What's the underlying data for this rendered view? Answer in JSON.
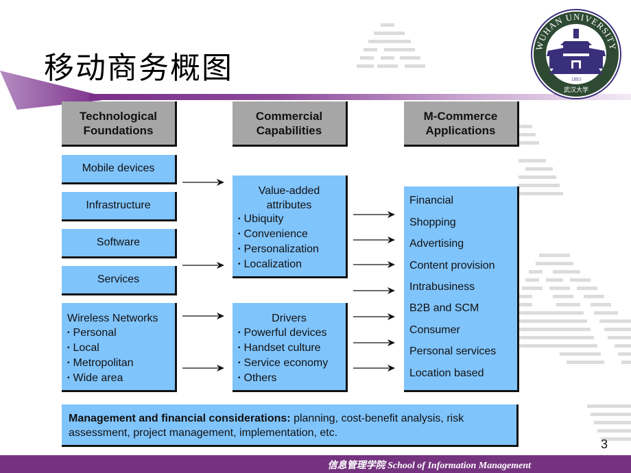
{
  "slide": {
    "title": "移动商务概图",
    "page_number": "3",
    "footer": "信息管理学院 School of Information Management",
    "colors": {
      "header_box": "#a6a6a6",
      "content_box": "#80c4fc",
      "accent_purple": "#75337f",
      "logo_green": "#2e4a33",
      "logo_purple": "#3a2f7a"
    },
    "logo": {
      "name": "wuhan-university-seal",
      "ring_text": "WUHAN UNIVERSITY",
      "year": "1893",
      "bottom_text": "武汉大学"
    }
  },
  "diagram": {
    "columns": [
      {
        "header": [
          "Technological",
          "Foundations"
        ]
      },
      {
        "header": [
          "Commercial",
          "Capabilities"
        ]
      },
      {
        "header": [
          "M-Commerce",
          "Applications"
        ]
      }
    ],
    "foundations": {
      "simple": [
        "Mobile devices",
        "Infrastructure",
        "Software",
        "Services"
      ],
      "wireless": {
        "title": "Wireless Networks",
        "items": [
          "Personal",
          "Local",
          "Metropolitan",
          "Wide area"
        ]
      }
    },
    "capabilities": {
      "value_added": {
        "title": [
          "Value-added",
          "attributes"
        ],
        "items": [
          "Ubiquity",
          "Convenience",
          "Personalization",
          "Localization"
        ]
      },
      "drivers": {
        "title": "Drivers",
        "items": [
          "Powerful devices",
          "Handset culture",
          "Service economy",
          "Others"
        ]
      }
    },
    "applications": [
      "Financial",
      "Shopping",
      "Advertising",
      "Content provision",
      "Intrabusiness",
      "B2B and SCM",
      "Consumer",
      "Personal services",
      "Location based"
    ],
    "management": {
      "label": "Management and financial considerations:",
      "text": " planning, cost-benefit analysis, risk assessment, project management, implementation, etc."
    }
  }
}
